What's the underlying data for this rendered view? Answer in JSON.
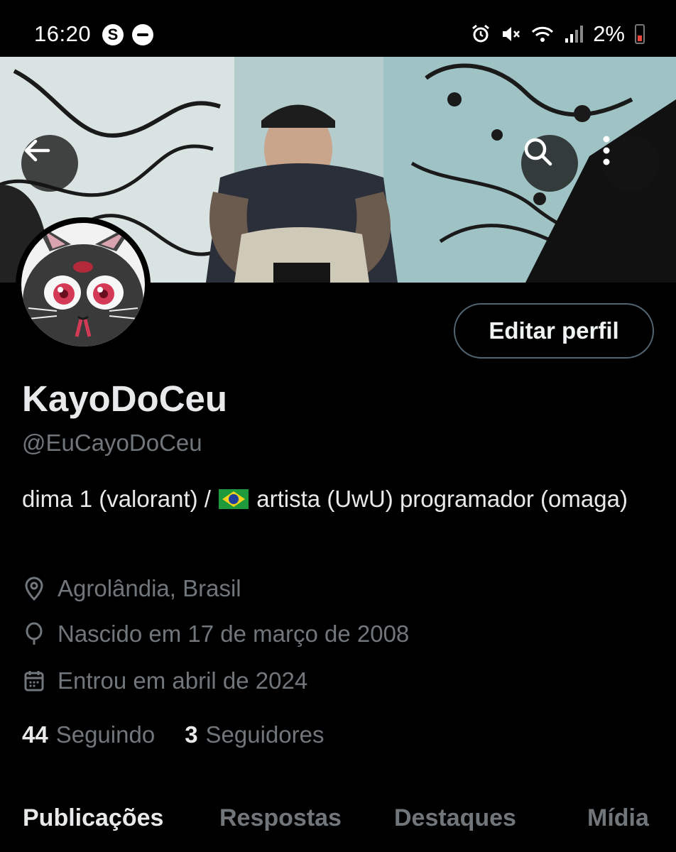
{
  "status_bar": {
    "time": "16:20",
    "app_icon_letter": "S",
    "battery": "2%",
    "icons": [
      "alarm-icon",
      "mute-icon",
      "wifi-icon",
      "signal-icon",
      "battery-icon"
    ]
  },
  "header": {
    "back_icon": "arrow-left-icon",
    "search_icon": "search-icon",
    "more_icon": "more-vertical-icon"
  },
  "profile": {
    "edit_label": "Editar perfil",
    "display_name": "KayoDoCeu",
    "handle": "@EuCayoDoCeu",
    "bio_part1": "dima 1 (valorant) /",
    "bio_part2": "artista (UwU)  programador (omaga)",
    "location": "Agrolândia, Brasil",
    "birth": "Nascido em 17 de março de 2008",
    "joined": "Entrou em abril de 2024"
  },
  "stats": {
    "following_count": "44",
    "following_label": "Seguindo",
    "followers_count": "3",
    "followers_label": "Seguidores"
  },
  "tabs": [
    {
      "label": "Publicações",
      "active": true
    },
    {
      "label": "Respostas",
      "active": false
    },
    {
      "label": "Destaques",
      "active": false
    },
    {
      "label": "Mídia",
      "active": false
    }
  ],
  "colors": {
    "background": "#000000",
    "primary_text": "#e7e9ea",
    "secondary_text": "#71767b",
    "border": "#536471"
  }
}
